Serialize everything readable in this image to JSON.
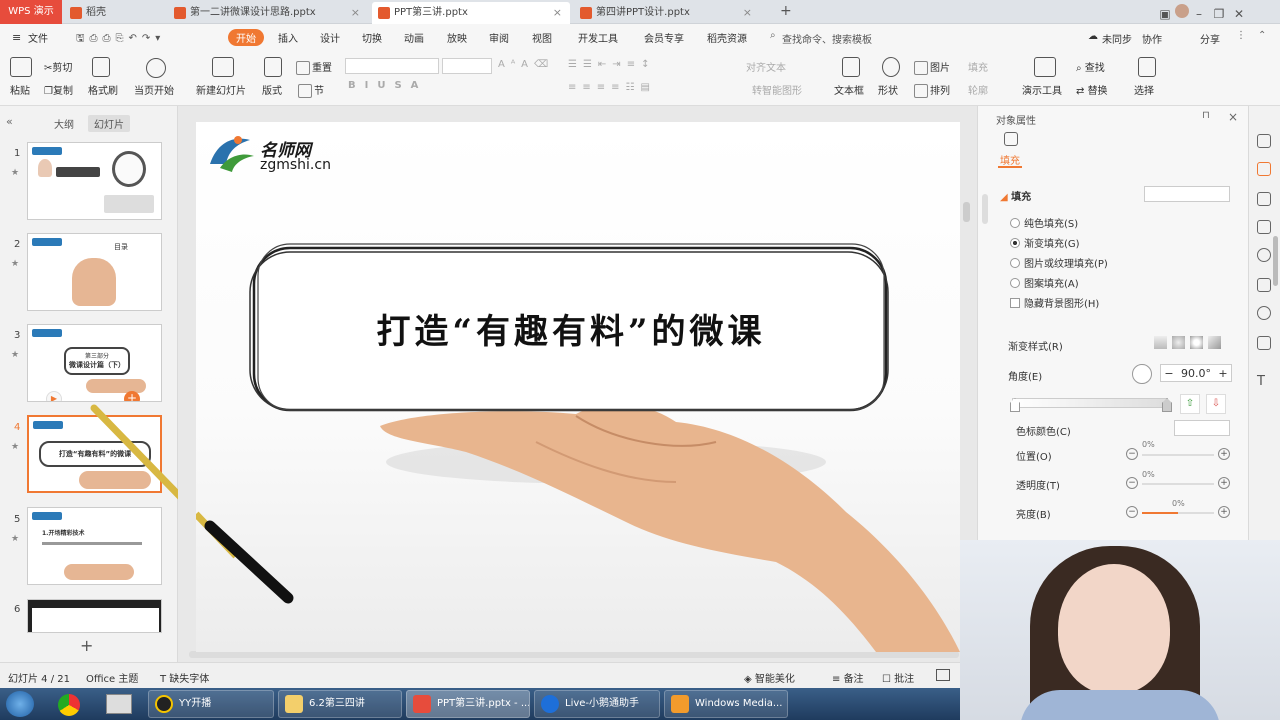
{
  "tabs": {
    "logo": "WPS 演示",
    "items": [
      {
        "label": "稻壳"
      },
      {
        "label": "第一二讲微课设计思路.pptx"
      },
      {
        "label": "PPT第三讲.pptx"
      },
      {
        "label": "第四讲PPT设计.pptx"
      }
    ],
    "add": "+"
  },
  "menu": {
    "file": "文件",
    "items": [
      "开始",
      "插入",
      "设计",
      "切换",
      "动画",
      "放映",
      "审阅",
      "视图",
      "开发工具",
      "会员专享",
      "稻壳资源"
    ],
    "search_placeholder": "查找命令、搜索模板",
    "sync": "未同步",
    "collab": "协作",
    "share": "分享"
  },
  "ribbon": {
    "paste": "粘贴",
    "cut": "剪切",
    "copy": "复制",
    "format_painter": "格式刷",
    "from_current": "当页开始",
    "new_slide": "新建幻灯片",
    "layout": "版式",
    "section": "节",
    "reset": "重置",
    "align_text": "对齐文本",
    "to_smartart": "转智能图形",
    "textbox": "文本框",
    "shape": "形状",
    "arrange": "排列",
    "picture": "图片",
    "fill": "填充",
    "outline": "轮廓",
    "present_tools": "演示工具",
    "find": "查找",
    "replace": "替换",
    "select": "选择"
  },
  "left_panel": {
    "tab_outline": "大纲",
    "tab_slides": "幻灯片",
    "slides": [
      {
        "num": "1"
      },
      {
        "num": "2",
        "title": "目录"
      },
      {
        "num": "3",
        "line1": "第三部分",
        "line2": "微课设计篇（下）"
      },
      {
        "num": "4",
        "text": "打造“有趣有料”的微课"
      },
      {
        "num": "5",
        "title": "1.开场精彩技术"
      },
      {
        "num": "6"
      }
    ],
    "add": "+"
  },
  "slide": {
    "logo_cn": "名师网",
    "logo_en": "zgmshi.cn",
    "headline": "打造“有趣有料”的微课"
  },
  "right_panel": {
    "title": "对象属性",
    "tab": "填充",
    "section": "填充",
    "options": [
      "纯色填充(S)",
      "渐变填充(G)",
      "图片或纹理填充(P)",
      "图案填充(A)"
    ],
    "hide_bg": "隐藏背景图形(H)",
    "gradient_style": "渐变样式(R)",
    "angle_label": "角度(E)",
    "angle_value": "90.0°",
    "stop_color": "色标颜色(C)",
    "position": "位置(O)",
    "transparency": "透明度(T)",
    "brightness": "亮度(B)",
    "position_value": "0%",
    "transparency_value": "0%",
    "brightness_value": "0%"
  },
  "status": {
    "slide_count": "幻灯片 4 / 21",
    "theme": "Office 主题",
    "missing_font": "缺失字体",
    "beautify": "智能美化",
    "notes": "备注",
    "comments": "批注"
  },
  "taskbar": {
    "items": [
      "YY开播",
      "6.2第三四讲",
      "PPT第三讲.pptx - ...",
      "Live-小鹅通助手",
      "Windows Media..."
    ]
  },
  "colors": {
    "accent": "#f07832",
    "wps_red": "#e74c3c"
  }
}
